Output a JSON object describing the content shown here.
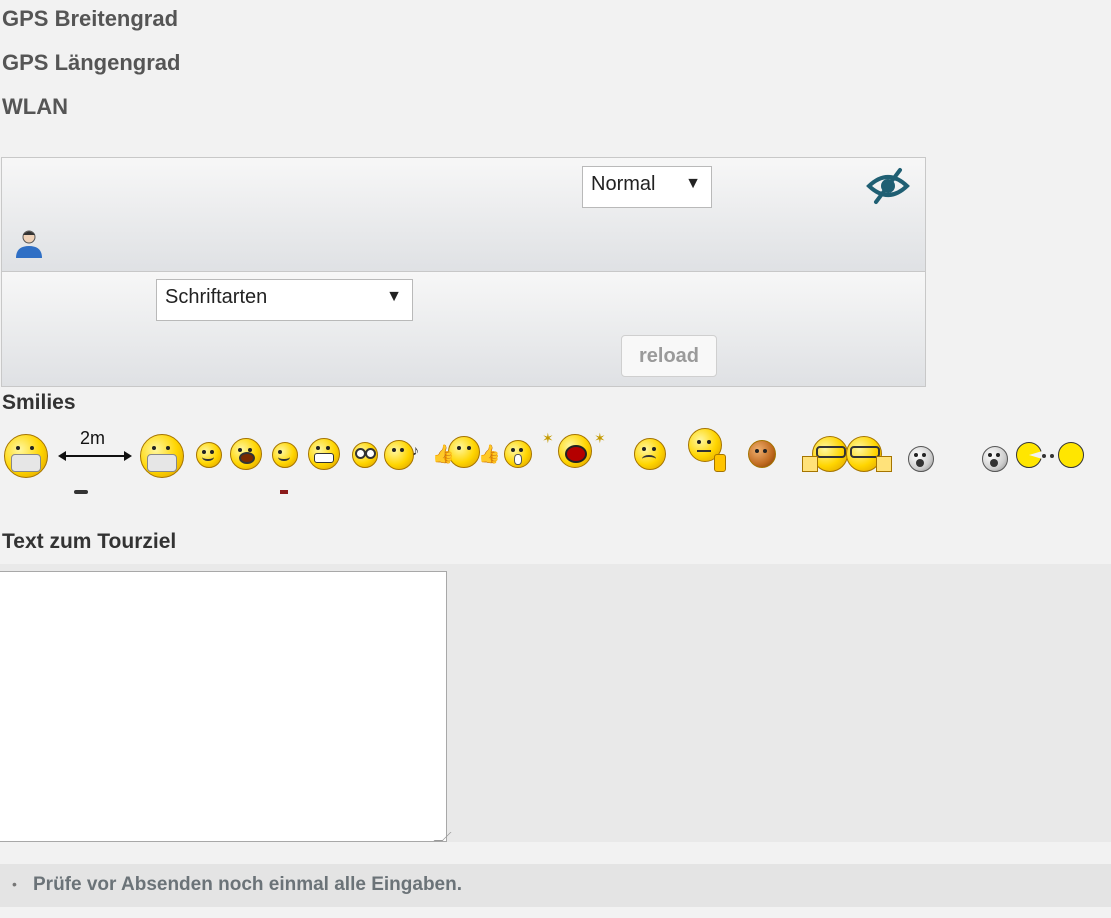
{
  "fields": {
    "latitude_label": "GPS Breitengrad",
    "longitude_label": "GPS Längengrad",
    "wlan_label": "WLAN"
  },
  "toolbar": {
    "size_select_value": "Normal",
    "font_select_value": "Schriftarten",
    "reload_label": "reload",
    "eye_icon": "eye-slash-icon",
    "user_icon": "user-icon"
  },
  "smilies": {
    "heading": "Smilies",
    "distance_label": "2m"
  },
  "tour": {
    "heading": "Text zum Tourziel",
    "text_value": ""
  },
  "notice": {
    "text": "Prüfe vor Absenden noch einmal alle Eingaben."
  },
  "colors": {
    "background": "#f2f2f2",
    "toolbar_top": "#f7f7f7",
    "toolbar_bottom": "#dfe1e4",
    "eye_icon": "#1f5f73"
  }
}
